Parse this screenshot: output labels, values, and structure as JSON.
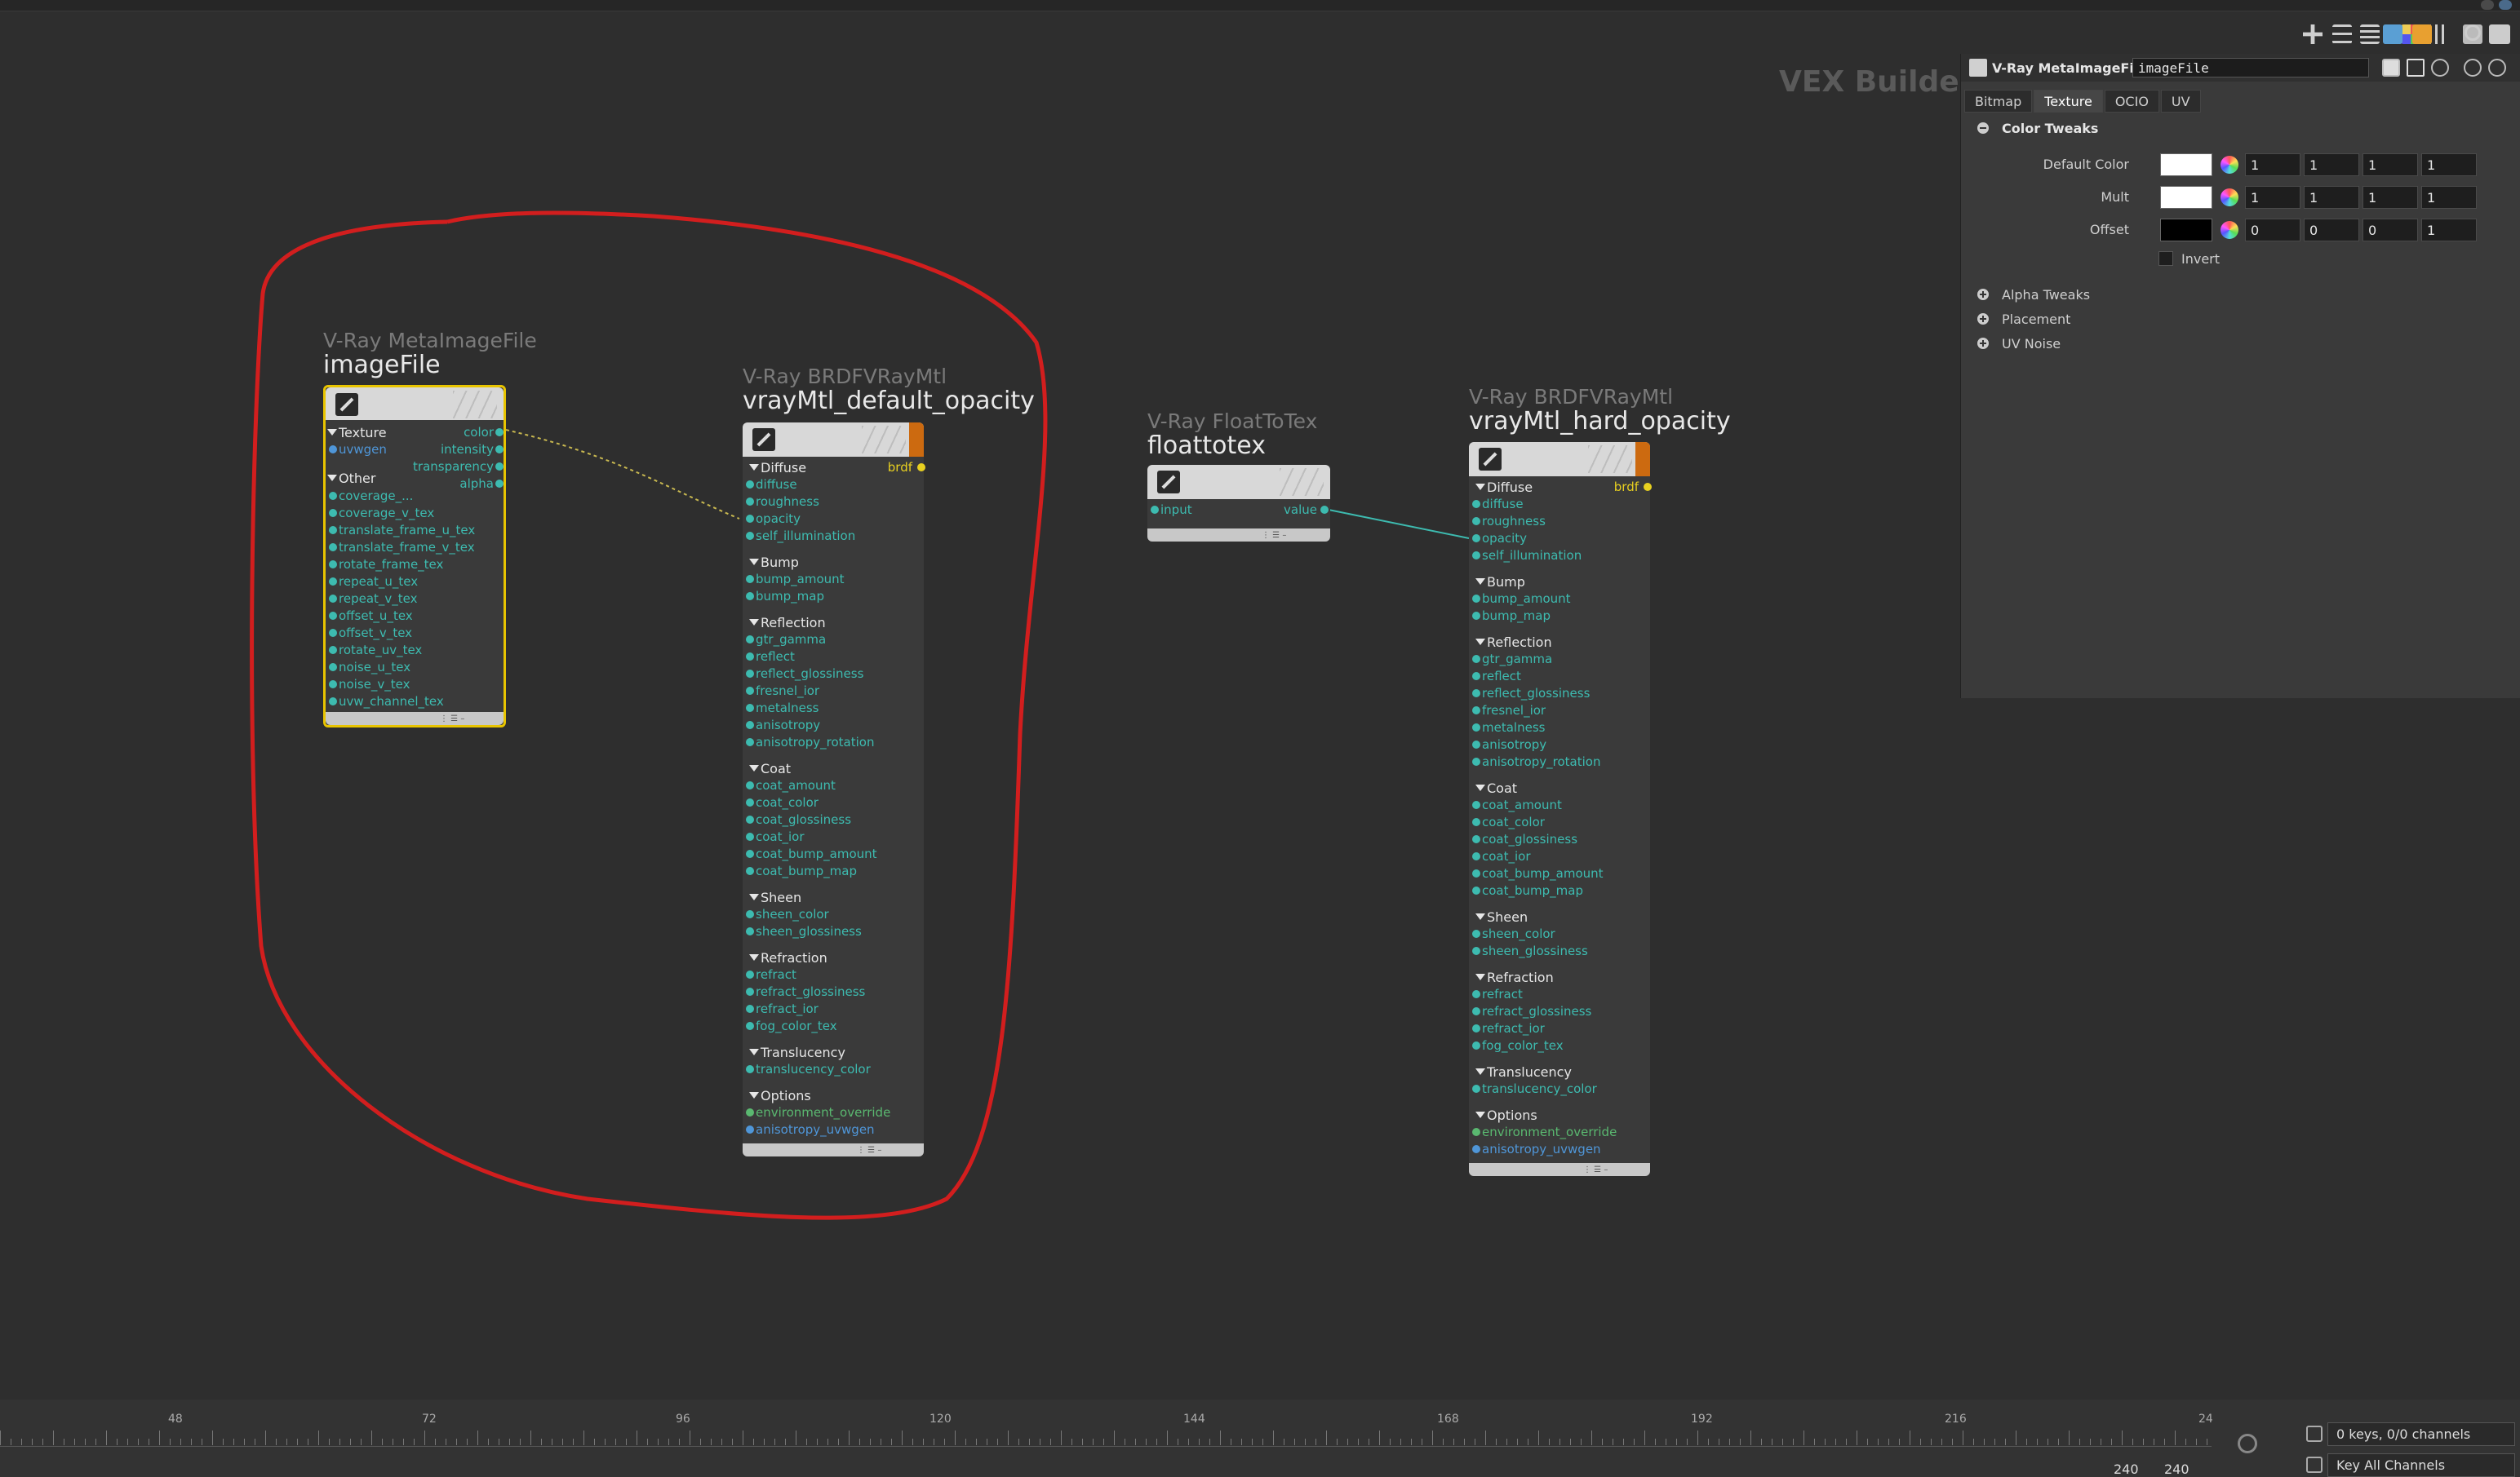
{
  "network": {
    "context_label": "VEX Builder"
  },
  "nodes": {
    "imagefile": {
      "type": "V-Ray MetaImageFile",
      "name": "imageFile",
      "sections": {
        "texture": "Texture",
        "other": "Other"
      },
      "inputs_texture": [
        "uvwgen"
      ],
      "inputs_other": [
        "coverage_...",
        "coverage_v_tex",
        "translate_frame_u_tex",
        "translate_frame_v_tex",
        "rotate_frame_tex",
        "repeat_u_tex",
        "repeat_v_tex",
        "offset_u_tex",
        "offset_v_tex",
        "rotate_uv_tex",
        "noise_u_tex",
        "noise_v_tex",
        "uvw_channel_tex"
      ],
      "outputs": [
        "color",
        "intensity",
        "transparency",
        "alpha"
      ]
    },
    "default_opacity": {
      "type": "V-Ray BRDFVRayMtl",
      "name": "vrayMtl_default_opacity",
      "output": "brdf"
    },
    "floattotex": {
      "type": "V-Ray FloatToTex",
      "name": "floattotex",
      "input": "input",
      "output": "value"
    },
    "hard_opacity": {
      "type": "V-Ray BRDFVRayMtl",
      "name": "vrayMtl_hard_opacity",
      "output": "brdf"
    }
  },
  "brdf_sections": [
    {
      "title": "Diffuse",
      "items": [
        "diffuse",
        "roughness",
        "opacity",
        "self_illumination"
      ]
    },
    {
      "title": "Bump",
      "items": [
        "bump_amount",
        "bump_map"
      ]
    },
    {
      "title": "Reflection",
      "items": [
        "gtr_gamma",
        "reflect",
        "reflect_glossiness",
        "fresnel_ior",
        "metalness",
        "anisotropy",
        "anisotropy_rotation"
      ]
    },
    {
      "title": "Coat",
      "items": [
        "coat_amount",
        "coat_color",
        "coat_glossiness",
        "coat_ior",
        "coat_bump_amount",
        "coat_bump_map"
      ]
    },
    {
      "title": "Sheen",
      "items": [
        "sheen_color",
        "sheen_glossiness"
      ]
    },
    {
      "title": "Refraction",
      "items": [
        "refract",
        "refract_glossiness",
        "refract_ior",
        "fog_color_tex"
      ]
    },
    {
      "title": "Translucency",
      "items": [
        "translucency_color"
      ]
    },
    {
      "title": "Options",
      "items": [
        "environment_override",
        "anisotropy_uvwgen"
      ]
    }
  ],
  "panel": {
    "node_type": "V-Ray MetaImageFile",
    "node_name": "imageFile",
    "tabs": [
      "Bitmap",
      "Texture",
      "OCIO",
      "UV"
    ],
    "active_tab": "Texture",
    "section": "Color Tweaks",
    "params": [
      {
        "label": "Default Color",
        "swatch": "#ffffff",
        "values": [
          "1",
          "1",
          "1",
          "1"
        ]
      },
      {
        "label": "Mult",
        "swatch": "#ffffff",
        "values": [
          "1",
          "1",
          "1",
          "1"
        ]
      },
      {
        "label": "Offset",
        "swatch": "#000000",
        "values": [
          "0",
          "0",
          "0",
          "1"
        ]
      }
    ],
    "invert_label": "Invert",
    "folders": [
      "Alpha Tweaks",
      "Placement",
      "UV Noise"
    ]
  },
  "timeline": {
    "ticks": [
      "48",
      "72",
      "96",
      "120",
      "144",
      "168",
      "192",
      "216",
      "24"
    ],
    "keys_label": "0 keys, 0/0 channels",
    "key_all_label": "Key All Channels",
    "frame_start": "240",
    "frame_end": "240"
  },
  "colors": {
    "annotation": "#d21e1e",
    "accent_orange": "#cc6a10",
    "socket_teal": "#3dbbb0",
    "socket_blue": "#4f96d8",
    "socket_yellow": "#e8d020"
  }
}
